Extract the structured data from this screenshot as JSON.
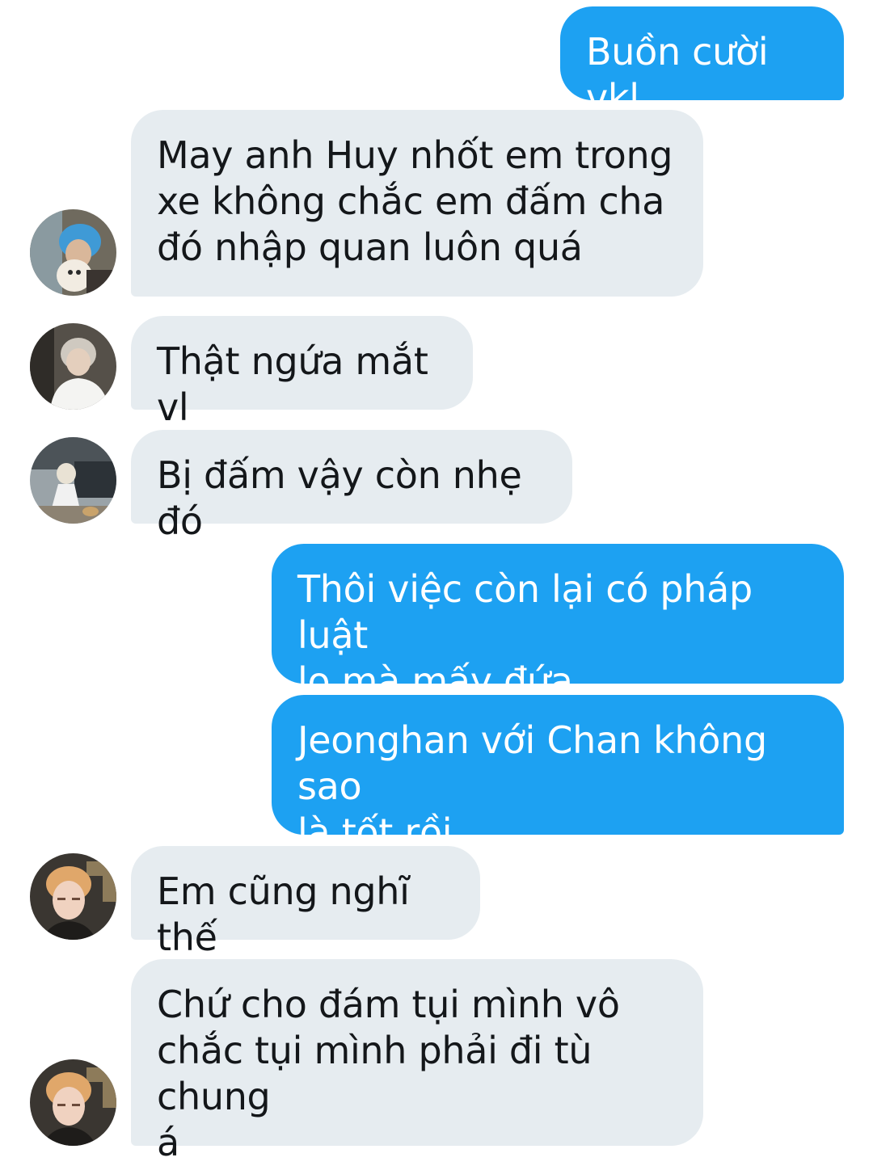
{
  "messages": [
    {
      "id": "m1",
      "sender": "self",
      "text": "Buồn cười vkl"
    },
    {
      "id": "m2",
      "sender": "other",
      "text": "May anh Huy nhốt em trong\nxe không chắc em đấm cha\nđó nhập quan luôn quá"
    },
    {
      "id": "m3",
      "sender": "other",
      "text": "Thật ngứa mắt vl"
    },
    {
      "id": "m4",
      "sender": "other",
      "text": "Bị đấm vậy còn nhẹ đó"
    },
    {
      "id": "m5",
      "sender": "self",
      "text": "Thôi việc còn lại có pháp luật\nlo mà mấy đứa"
    },
    {
      "id": "m6",
      "sender": "self",
      "text": "Jeonghan với Chan không sao\nlà tốt rồi"
    },
    {
      "id": "m7",
      "sender": "other",
      "text": "Em cũng nghĩ thế"
    },
    {
      "id": "m8",
      "sender": "other",
      "text": "Chứ cho đám tụi mình vô\nchắc tụi mình phải đi tù chung\ná"
    }
  ],
  "colors": {
    "outgoing_bubble": "#1da1f2",
    "incoming_bubble": "#e6ecf0",
    "outgoing_text": "#ffffff",
    "incoming_text": "#14171a"
  },
  "avatars": [
    {
      "for": "m2",
      "icon": "user-avatar-blue-hair-with-dog"
    },
    {
      "for": "m3",
      "icon": "user-avatar-white-shirt"
    },
    {
      "for": "m4",
      "icon": "user-avatar-outdoor-crouching"
    },
    {
      "for": "m7",
      "icon": "user-avatar-blond"
    },
    {
      "for": "m8",
      "icon": "user-avatar-blond"
    }
  ]
}
